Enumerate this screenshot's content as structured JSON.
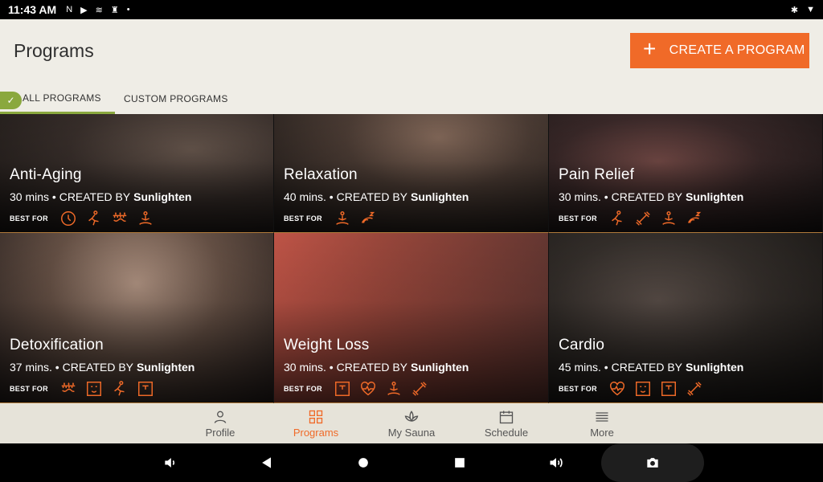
{
  "status": {
    "time": "11:43 AM"
  },
  "header": {
    "title": "Programs",
    "create_label": "CREATE A PROGRAM"
  },
  "tabs": [
    {
      "label": "ALL PROGRAMS"
    },
    {
      "label": "CUSTOM PROGRAMS"
    }
  ],
  "programs": [
    {
      "name": "Anti-Aging",
      "duration": "30 mins •",
      "created_by": "CREATED BY",
      "author": "Sunlighten",
      "best_for": "BEST FOR",
      "icons": [
        "clock-icon",
        "stretch-icon",
        "heat-panel-icon",
        "meditation-icon"
      ]
    },
    {
      "name": "Relaxation",
      "duration": "40 mins. •",
      "created_by": "CREATED BY",
      "author": "Sunlighten",
      "best_for": "BEST FOR",
      "icons": [
        "meditation-icon",
        "sleep-icon"
      ]
    },
    {
      "name": "Pain Relief",
      "duration": "30 mins. •",
      "created_by": "CREATED BY",
      "author": "Sunlighten",
      "best_for": "BEST FOR",
      "icons": [
        "stretch-icon",
        "dumbbell-icon",
        "meditation-icon",
        "sleep-icon"
      ]
    },
    {
      "name": "Detoxification",
      "duration": "37 mins. •",
      "created_by": "CREATED BY",
      "author": "Sunlighten",
      "best_for": "BEST FOR",
      "icons": [
        "heat-panel-icon",
        "face-icon",
        "stretch-icon",
        "scale-icon"
      ]
    },
    {
      "name": "Weight Loss",
      "duration": "30 mins. •",
      "created_by": "CREATED BY",
      "author": "Sunlighten",
      "best_for": "BEST FOR",
      "icons": [
        "scale-icon",
        "heart-rate-icon",
        "meditation-icon",
        "dumbbell-icon"
      ]
    },
    {
      "name": "Cardio",
      "duration": "45 mins. •",
      "created_by": "CREATED BY",
      "author": "Sunlighten",
      "best_for": "BEST FOR",
      "icons": [
        "heart-rate-icon",
        "face-icon",
        "scale-icon",
        "dumbbell-icon"
      ]
    }
  ],
  "bottom_nav": [
    {
      "label": "Profile"
    },
    {
      "label": "Programs"
    },
    {
      "label": "My Sauna"
    },
    {
      "label": "Schedule"
    },
    {
      "label": "More"
    }
  ],
  "colors": {
    "accent": "#f06a28",
    "tab_indicator": "#8aa83e",
    "header_bg": "#efede6"
  }
}
